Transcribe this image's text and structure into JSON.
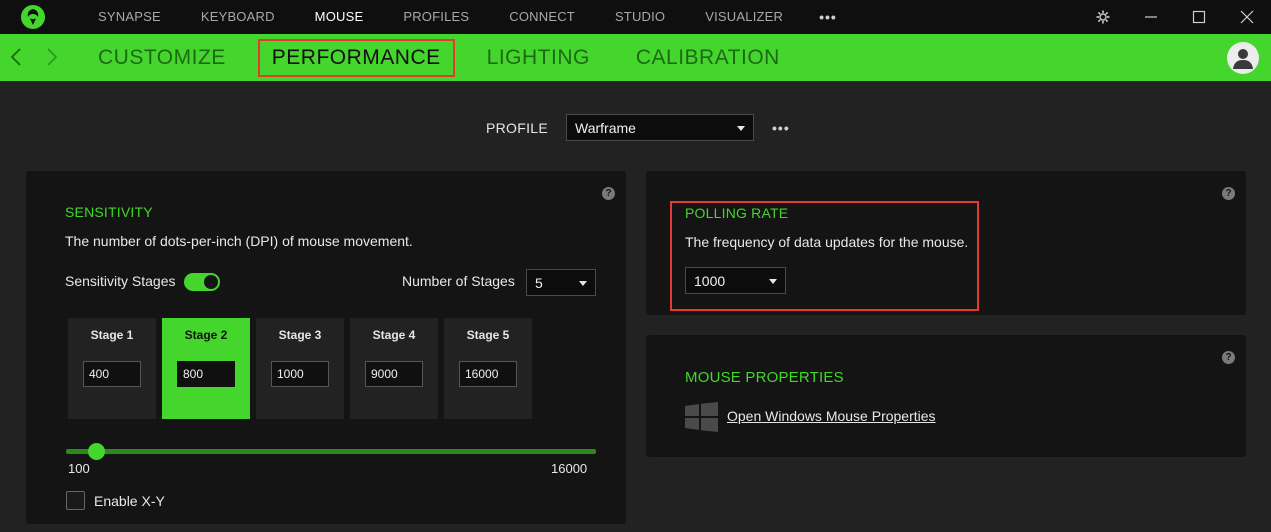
{
  "top_nav": {
    "items": [
      "SYNAPSE",
      "KEYBOARD",
      "MOUSE",
      "PROFILES",
      "CONNECT",
      "STUDIO",
      "VISUALIZER"
    ],
    "active": "MOUSE",
    "more": "•••"
  },
  "window_controls": [
    "gear-icon",
    "minimize-icon",
    "maximize-icon",
    "close-icon"
  ],
  "sub_tabs": {
    "items": [
      "CUSTOMIZE",
      "PERFORMANCE",
      "LIGHTING",
      "CALIBRATION"
    ],
    "active": "PERFORMANCE"
  },
  "profile": {
    "label": "PROFILE",
    "value": "Warframe",
    "more": "•••"
  },
  "sensitivity": {
    "title": "SENSITIVITY",
    "description": "The number of dots-per-inch (DPI) of mouse movement.",
    "stages_label": "Sensitivity Stages",
    "stages_enabled": true,
    "num_stages_label": "Number of Stages",
    "num_stages_value": "5",
    "stages": [
      {
        "label": "Stage 1",
        "value": "400"
      },
      {
        "label": "Stage 2",
        "value": "800"
      },
      {
        "label": "Stage 3",
        "value": "1000"
      },
      {
        "label": "Stage 4",
        "value": "9000"
      },
      {
        "label": "Stage 5",
        "value": "16000"
      }
    ],
    "active_stage": 1,
    "slider_min": "100",
    "slider_max": "16000",
    "slider_value": 800,
    "enable_xy_label": "Enable X-Y",
    "enable_xy": false,
    "help": "?"
  },
  "polling": {
    "title": "POLLING RATE",
    "description": "The frequency of data updates for the mouse.",
    "value": "1000",
    "help": "?"
  },
  "mouse_properties": {
    "title": "MOUSE PROPERTIES",
    "link": "Open Windows Mouse Properties",
    "help": "?"
  },
  "colors": {
    "accent": "#44d62c",
    "highlight": "#e33b2f",
    "background": "#222222",
    "panel": "#141414"
  }
}
